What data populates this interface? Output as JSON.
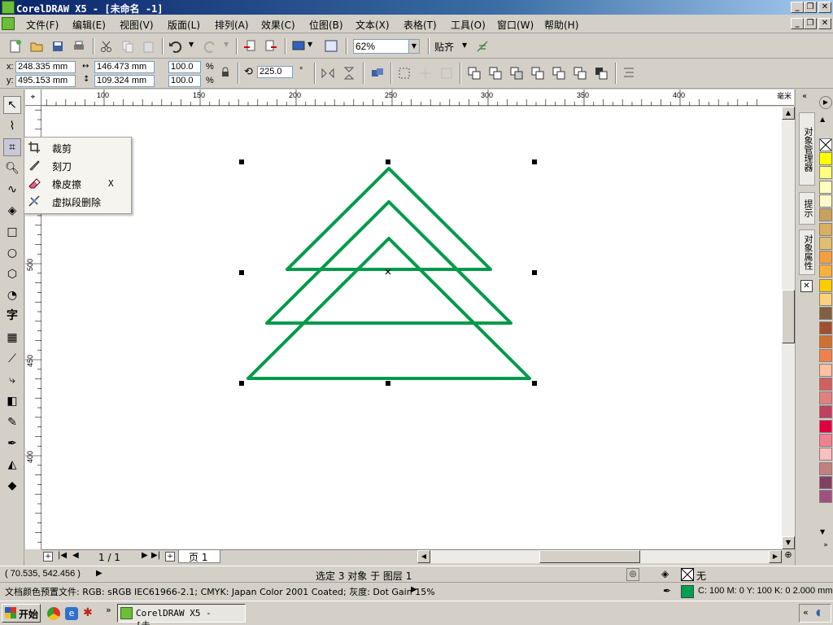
{
  "window": {
    "title": "CorelDRAW X5 - [未命名 -1]",
    "btn_min": "_",
    "btn_max": "❐",
    "btn_close": "✕"
  },
  "menu": [
    {
      "label": "文件(F)"
    },
    {
      "label": "编辑(E)"
    },
    {
      "label": "视图(V)"
    },
    {
      "label": "版面(L)"
    },
    {
      "label": "排列(A)"
    },
    {
      "label": "效果(C)"
    },
    {
      "label": "位图(B)"
    },
    {
      "label": "文本(X)"
    },
    {
      "label": "表格(T)"
    },
    {
      "label": "工具(O)"
    },
    {
      "label": "窗口(W)"
    },
    {
      "label": "帮助(H)"
    }
  ],
  "toolbar": {
    "zoom_value": "62%",
    "snap_label": "贴齐"
  },
  "property_bar": {
    "x_label": "x:",
    "y_label": "y:",
    "x_value": "248.335 mm",
    "y_value": "495.153 mm",
    "width_value": "146.473 mm",
    "height_value": "109.324 mm",
    "scale_x": "100.0",
    "scale_y": "100.0",
    "percent": "%",
    "rotation": "225.0",
    "degree": "°"
  },
  "ruler": {
    "unit": "毫米",
    "h_ticks": [
      {
        "label": "100",
        "value": 100
      },
      {
        "label": "150",
        "value": 150
      },
      {
        "label": "200",
        "value": 200
      },
      {
        "label": "250",
        "value": 250
      },
      {
        "label": "300",
        "value": 300
      },
      {
        "label": "350",
        "value": 350
      },
      {
        "label": "400",
        "value": 400
      }
    ],
    "v_ticks": [
      {
        "label": "500",
        "value": 500
      },
      {
        "label": "450",
        "value": 450
      },
      {
        "label": "400",
        "value": 400
      }
    ]
  },
  "flyout": {
    "items": [
      {
        "label": "裁剪",
        "key": "",
        "icon": "crop-icon"
      },
      {
        "label": "刻刀",
        "key": "",
        "icon": "knife-icon"
      },
      {
        "label": "橡皮擦",
        "key": "X",
        "icon": "eraser-icon"
      },
      {
        "label": "虚拟段删除",
        "key": "",
        "icon": "virtual-segment-delete-icon"
      }
    ]
  },
  "docker": {
    "tabs": [
      {
        "label": "对象管理器"
      },
      {
        "label": "提示"
      },
      {
        "label": "对象属性"
      }
    ]
  },
  "palette": {
    "colors": [
      "#ffff00",
      "#ffff80",
      "#ffffc0",
      "#fff9c8",
      "#c8a060",
      "#d8b060",
      "#e0c070",
      "#f0a040",
      "#f8b040",
      "#ffcc00",
      "#ffd080",
      "#806040",
      "#a05030",
      "#d07030",
      "#f08050",
      "#ffc0a0",
      "#d06060",
      "#e08080",
      "#c04060",
      "#e00040",
      "#f08090",
      "#f8c0c0",
      "#c08080",
      "#804060",
      "#a05080"
    ]
  },
  "page": {
    "counter": "1 / 1",
    "tab_label": "页 1"
  },
  "status": {
    "coords": "( 70.535, 542.456 )",
    "selection": "选定 3 对象 于 图层 1",
    "fill_label": "无",
    "profile": "文档颜色预置文件: RGB: sRGB IEC61966-2.1; CMYK: Japan Color 2001 Coated; 灰度: Dot Gain 15%",
    "outline": "C: 100 M: 0 Y: 100 K: 0  2.000 mm",
    "outline_color": "#00a050",
    "shape_color": "#009a4a"
  },
  "taskbar": {
    "start": "开始",
    "task": "CorelDRAW X5 - [未..."
  }
}
